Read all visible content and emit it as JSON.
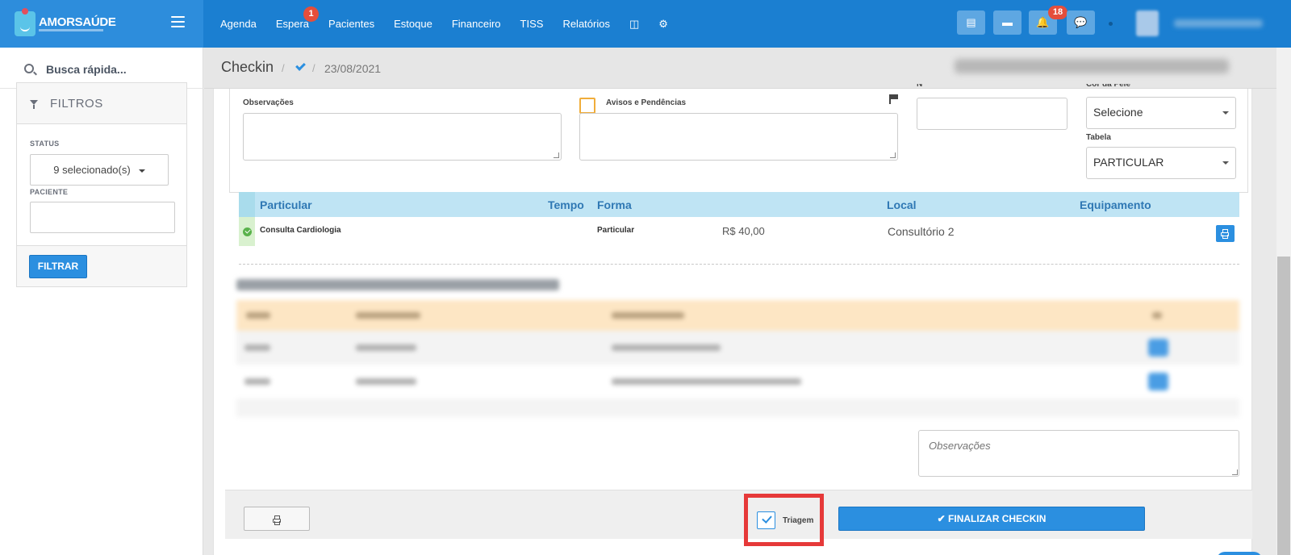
{
  "brand": {
    "name": "AMORSAÚDE"
  },
  "nav": {
    "items": [
      {
        "label": "Agenda"
      },
      {
        "label": "Espera",
        "badge": "1"
      },
      {
        "label": "Pacientes"
      },
      {
        "label": "Estoque"
      },
      {
        "label": "Financeiro"
      },
      {
        "label": "TISS"
      },
      {
        "label": "Relatórios"
      }
    ],
    "icons": [
      "database-icon",
      "gear-icon"
    ]
  },
  "toolbar": {
    "notifications_badge": "18"
  },
  "sidebar": {
    "search_placeholder": "Busca rápida...",
    "filters_title": "FILTROS",
    "status_label": "STATUS",
    "status_value": "9 selecionado(s)",
    "patient_label": "PACIENTE",
    "filter_button": "FILTRAR"
  },
  "header": {
    "title": "Checkin",
    "separator": "/",
    "date": "23/08/2021"
  },
  "form": {
    "observacoes_label": "Observações",
    "avisos_label": "Avisos e Pendências",
    "select_value": "Selecione",
    "tabela_label": "Tabela",
    "tabela_value": "PARTICULAR"
  },
  "table": {
    "headers": {
      "particular": "Particular",
      "tempo": "Tempo",
      "forma": "Forma",
      "local": "Local",
      "equipamento": "Equipamento"
    },
    "rows": [
      {
        "procedimento": "Consulta Cardiologia",
        "forma": "Particular",
        "valor": "R$ 40,00",
        "local": "Consultório 2"
      }
    ]
  },
  "notes": {
    "placeholder": "Observações"
  },
  "footer": {
    "triagem_label": "Triagem",
    "triagem_checked": true,
    "finalize_label": "FINALIZAR CHECKIN",
    "finalize_icon": "✔"
  },
  "colors": {
    "primary": "#2b8fe0",
    "topbar": "#1b7fd1",
    "badge": "#e54e3b",
    "highlight": "#e63939"
  }
}
